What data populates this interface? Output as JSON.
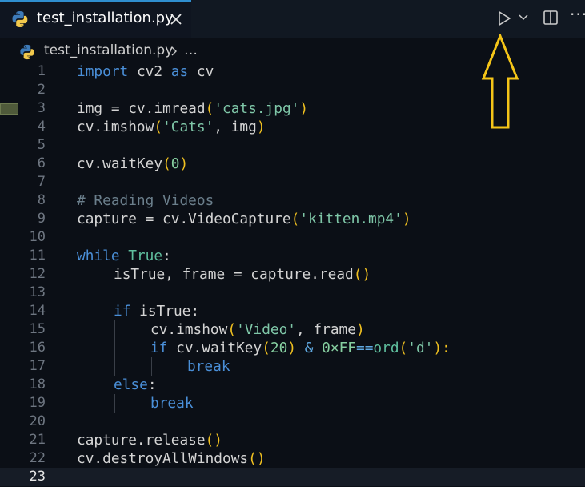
{
  "tab": {
    "title": "test_installation.py"
  },
  "toolbar": {
    "more_label": "···"
  },
  "breadcrumb": {
    "file": "test_installation.py",
    "more": "…"
  },
  "editor": {
    "current_line": 23,
    "line_numbers": [
      "1",
      "2",
      "3",
      "4",
      "5",
      "6",
      "7",
      "8",
      "9",
      "10",
      "11",
      "12",
      "13",
      "14",
      "15",
      "16",
      "17",
      "18",
      "19",
      "20",
      "21",
      "22",
      "23"
    ],
    "code": {
      "l1": [
        "import",
        " cv2 ",
        "as",
        " cv"
      ],
      "l3": [
        "img = cv.imread",
        "(",
        "'cats.jpg'",
        ")"
      ],
      "l4": [
        "cv.imshow",
        "(",
        "'Cats'",
        ", img",
        ")"
      ],
      "l6": [
        "cv.waitKey",
        "(",
        "0",
        ")"
      ],
      "l8": [
        "# Reading Videos"
      ],
      "l9": [
        "capture = cv.VideoCapture",
        "(",
        "'kitten.mp4'",
        ")"
      ],
      "l11": [
        "while",
        " ",
        "True",
        ":"
      ],
      "l12": [
        "isTrue, frame = capture.read",
        "()"
      ],
      "l14": [
        "if",
        " isTrue:"
      ],
      "l15": [
        "cv.imshow",
        "(",
        "'Video'",
        ", frame",
        ")"
      ],
      "l16": [
        "if",
        " cv.waitKey",
        "(",
        "20",
        ")",
        " & ",
        "0×FF",
        "==",
        "ord",
        "(",
        "'d'",
        "):"
      ],
      "l17": [
        "break"
      ],
      "l18": [
        "else",
        ":"
      ],
      "l19": [
        "break"
      ],
      "l21": [
        "capture.release",
        "()"
      ],
      "l22": [
        "cv.destroyAllWindows",
        "()"
      ]
    }
  },
  "colors": {
    "accent": "#2f8fd0",
    "keyword": "#4a8fd8",
    "string": "#7fc7a8",
    "bracket": "#f0c020",
    "annotation_arrow": "#f5c518"
  },
  "icons": [
    "python-file-icon",
    "close-icon",
    "run-icon",
    "chevron-down-icon",
    "split-editor-icon",
    "more-actions-icon",
    "chevron-right-icon",
    "yellow-arrow-annotation"
  ]
}
